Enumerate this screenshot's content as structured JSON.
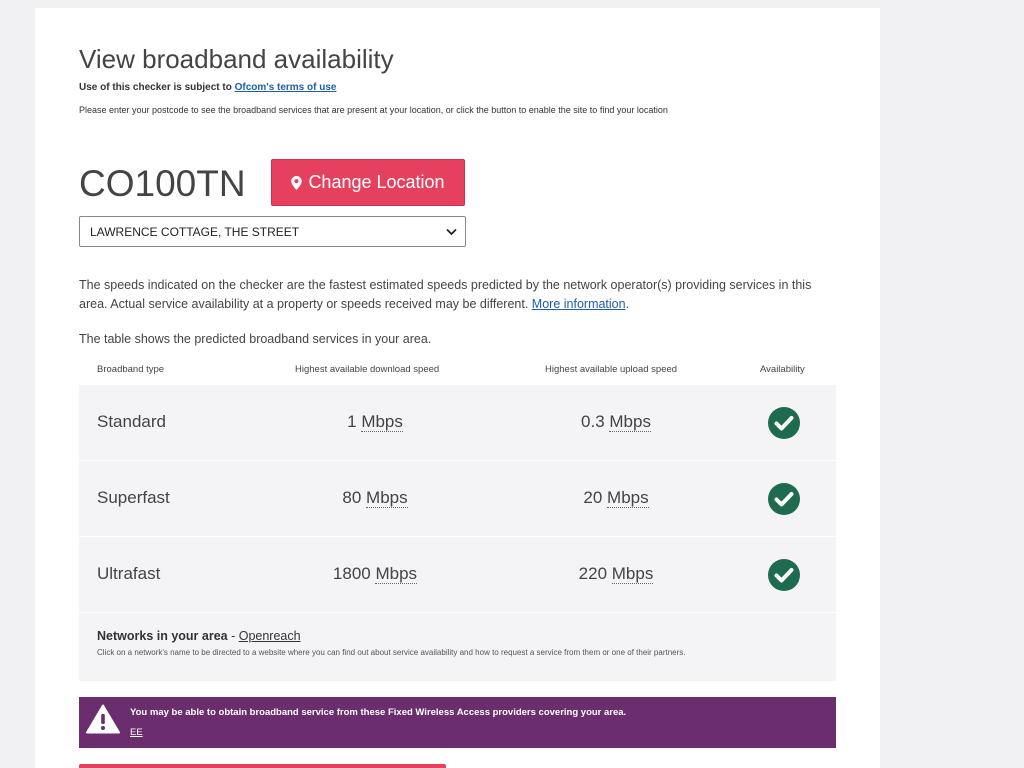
{
  "page": {
    "title": "View broadband availability",
    "terms_prefix": "Use of this checker is subject to ",
    "terms_link": "Ofcom's terms of use",
    "intro": "Please enter your postcode to see the broadband services that are present at your location, or click the button to enable the site to find your location"
  },
  "location": {
    "postcode": "CO100TN",
    "change_button": "Change Location",
    "address_selected": "LAWRENCE COTTAGE, THE STREET"
  },
  "disclaimer": {
    "text": "The speeds indicated on the checker are the fastest estimated speeds predicted by the network operator(s) providing services in this area. Actual service availability at a property or speeds received may be different. ",
    "link": "More information",
    "end": "."
  },
  "table": {
    "intro": "The table shows the predicted broadband services in your area.",
    "headers": [
      "Broadband type",
      "Highest available download speed",
      "Highest available upload speed",
      "Availability"
    ],
    "rows": [
      {
        "type": "Standard",
        "down": "1",
        "up": "0.3",
        "unit": "Mbps",
        "available": true
      },
      {
        "type": "Superfast",
        "down": "80",
        "up": "20",
        "unit": "Mbps",
        "available": true
      },
      {
        "type": "Ultrafast",
        "down": "1800",
        "up": "220",
        "unit": "Mbps",
        "available": true
      }
    ],
    "networks_label": "Networks in your area",
    "networks_sep": " - ",
    "networks_link": "Openreach",
    "networks_note": "Click on a network's name to be directed to a website where you can find out about service availability and how to request a service from them or one of their partners."
  },
  "fwa": {
    "message": "You may be able to obtain broadband service from these Fixed Wireless Access providers covering your area.",
    "provider": "EE"
  },
  "icons": {
    "location": "map-marker-icon",
    "dropdown": "chevron-down-icon",
    "availability": "check-circle-icon",
    "warning": "warning-triangle-icon"
  },
  "colors": {
    "accent": "#e5415f",
    "check": "#1e6b4f",
    "banner": "#6b2d6e",
    "link": "#1d5fa5"
  }
}
